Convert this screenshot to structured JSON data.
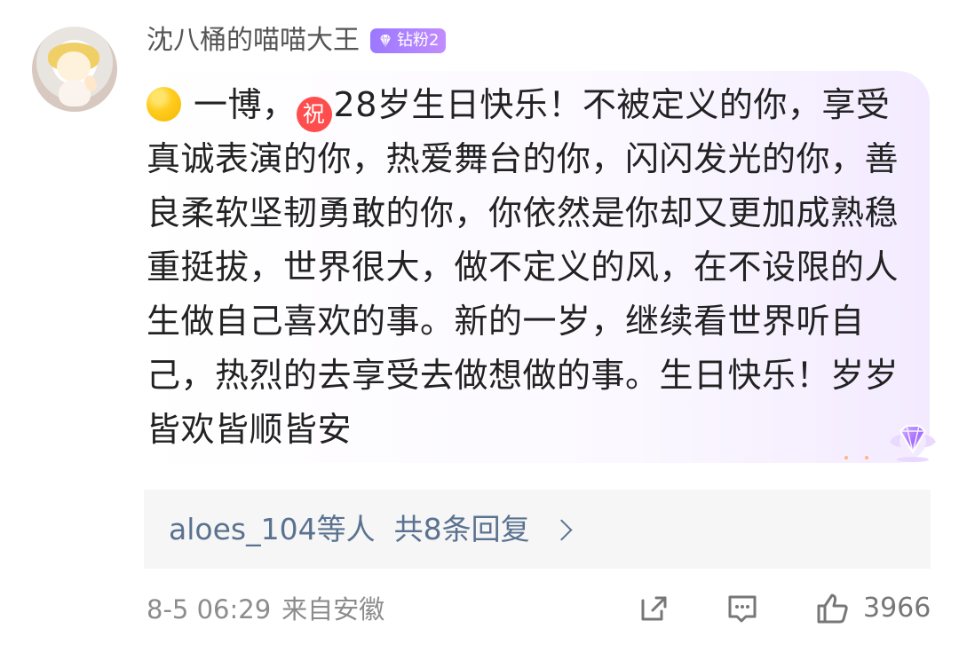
{
  "user": {
    "name": "沈八桶的喵喵大王",
    "badge": "钻粉2"
  },
  "comment": {
    "text_after_yellow_emoji": "一博，",
    "congrats_glyph": "祝",
    "text_main": "28岁生日快乐！不被定义的你，享受真诚表演的你，热爱舞台的你，闪闪发光的你，善良柔软坚韧勇敢的你，你依然是你却又更加成熟稳重挺拔，世界很大，做不定义的风，在不设限的人生做自己喜欢的事。新的一岁，继续看世界听自己，热烈的去享受去做想做的事。生日快乐！岁岁皆欢皆顺皆安"
  },
  "replies": {
    "users": "aloes_104等人",
    "count_text": "共8条回复"
  },
  "meta": {
    "time": "8-5 06:29",
    "location": "来自安徽"
  },
  "actions": {
    "like_count": "3966"
  },
  "icons": {
    "yellow_emoji": "yellow-circle-emoji-icon",
    "congrats": "congrats-badge-icon",
    "diamond": "diamond-icon",
    "share": "share-icon",
    "comment": "comment-icon",
    "like": "thumbs-up-icon",
    "chevron": "chevron-right-icon"
  },
  "colors": {
    "username": "#555555",
    "reply_link": "#5a7290",
    "meta": "#8c8c8c",
    "badge_start": "#9b78ff",
    "badge_end": "#c18cff",
    "congrats": "#ff4d4d",
    "bubble_tint": "#f3eaff"
  }
}
